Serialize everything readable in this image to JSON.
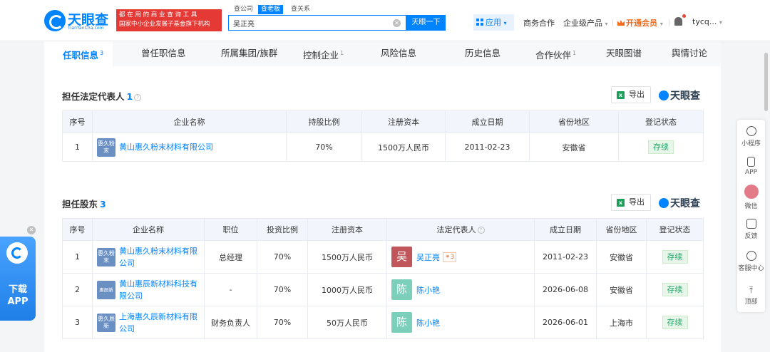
{
  "brand": {
    "name": "天眼查",
    "sub": "TianYanCha.com",
    "slogan_line1": "都 在 用 的 商 业 查 询 工 具",
    "slogan_line2": "国家中小企业发展子基金旗下机构"
  },
  "search": {
    "tabs": [
      "查公司",
      "查老板",
      "查关系"
    ],
    "active_tab": "查老板",
    "value": "吴正亮",
    "button": "天眼一下"
  },
  "header_nav": {
    "apps": "应用",
    "business": "商务合作",
    "enterprise": "企业级产品",
    "vip": "开通会员",
    "user": "tycq..."
  },
  "tabs": [
    {
      "label": "任职信息",
      "count": "3",
      "active": true
    },
    {
      "label": "曾任职信息",
      "count": ""
    },
    {
      "label": "所属集团/族群",
      "count": ""
    },
    {
      "label": "控制企业",
      "count": "1"
    },
    {
      "label": "风险信息",
      "count": ""
    },
    {
      "label": "历史信息",
      "count": ""
    },
    {
      "label": "合作伙伴",
      "count": "1"
    },
    {
      "label": "天眼图谱",
      "count": ""
    },
    {
      "label": "舆情讨论",
      "count": ""
    }
  ],
  "legal_rep": {
    "title": "担任法定代表人",
    "count": "1",
    "export": "导出",
    "brand": "天眼查",
    "headers": [
      "序号",
      "企业名称",
      "持股比例",
      "注册资本",
      "成立日期",
      "省份地区",
      "登记状态"
    ],
    "rows": [
      {
        "no": "1",
        "logo": "惠久粉末",
        "company": "黄山惠久粉末材料有限公司",
        "share": "70%",
        "capital": "1500万人民币",
        "date": "2011-02-23",
        "region": "安徽省",
        "status": "存续"
      }
    ]
  },
  "shareholder": {
    "title": "担任股东",
    "count": "3",
    "export": "导出",
    "brand": "天眼查",
    "headers": [
      "序号",
      "企业名称",
      "职位",
      "投资比例",
      "注册资本",
      "法定代表人",
      "成立日期",
      "省份地区",
      "登记状态"
    ],
    "rows": [
      {
        "no": "1",
        "logo": "惠久粉末",
        "company": "黄山惠久粉末材料有限公司",
        "position": "总经理",
        "ratio": "70%",
        "capital": "1500万人民币",
        "rep_char": "吴",
        "rep": "吴正亮",
        "rep_count": "3",
        "rep_color": "#c1565a",
        "date": "2011-02-23",
        "region": "安徽省",
        "status": "存续"
      },
      {
        "no": "2",
        "logo": "惠辰新",
        "company": "黄山惠辰新材料科技有限公司",
        "position": "-",
        "ratio": "70%",
        "capital": "1000万人民币",
        "rep_char": "陈",
        "rep": "陈小艳",
        "rep_count": "",
        "rep_color": "#7ccfbb",
        "date": "2026-06-08",
        "region": "安徽省",
        "status": "存续"
      },
      {
        "no": "3",
        "logo": "惠久辰新",
        "company": "上海惠久辰新材料有限公司",
        "position": "财务负责人",
        "ratio": "70%",
        "capital": "50万人民币",
        "rep_char": "陈",
        "rep": "陈小艳",
        "rep_count": "",
        "rep_color": "#7ccfbb",
        "date": "2026-06-01",
        "region": "上海市",
        "status": "存续"
      }
    ]
  },
  "sidebar": [
    {
      "label": "小程序",
      "icon": "mini-program-icon"
    },
    {
      "label": "APP",
      "icon": "phone-icon"
    },
    {
      "label": "微信",
      "icon": "wechat-qr-icon"
    },
    {
      "label": "反馈",
      "icon": "feedback-icon"
    },
    {
      "label": "客服中心",
      "icon": "headset-icon"
    },
    {
      "label": "顶部",
      "icon": "back-to-top-icon"
    }
  ],
  "app_float": {
    "line1": "下载",
    "line2": "APP"
  },
  "colors": {
    "primary": "#0084ff",
    "vip": "#f26b1d",
    "status_green": "#1ea86a",
    "slogan_red": "#e53935"
  }
}
